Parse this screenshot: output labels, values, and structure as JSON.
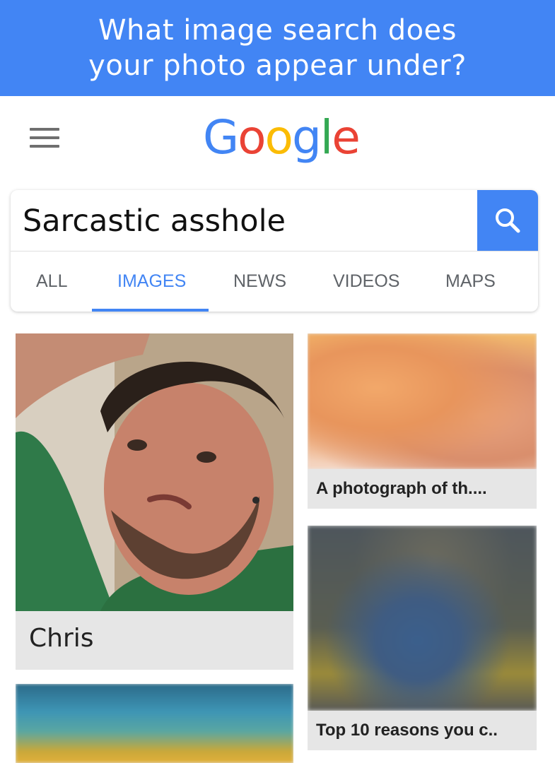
{
  "banner": {
    "line1": "What image search does",
    "line2": "your photo appear under?",
    "background": "#4285f4"
  },
  "header": {
    "menu_icon": "hamburger-menu-icon",
    "logo_letters": [
      "G",
      "o",
      "o",
      "g",
      "l",
      "e"
    ],
    "logo_colors": [
      "#4285f4",
      "#ea4335",
      "#fbbc05",
      "#4285f4",
      "#34a853",
      "#ea4335"
    ]
  },
  "search": {
    "query": "Sarcastic asshole",
    "button_icon": "search-icon",
    "accent": "#4285f4"
  },
  "tabs": [
    {
      "label": "ALL",
      "active": false
    },
    {
      "label": "IMAGES",
      "active": true
    },
    {
      "label": "NEWS",
      "active": false
    },
    {
      "label": "VIDEOS",
      "active": false
    },
    {
      "label": "MAPS",
      "active": false
    }
  ],
  "results": [
    {
      "caption": "Chris"
    },
    {
      "caption": "A photograph of th...."
    },
    {
      "caption": "Top 10 reasons you c.."
    },
    {
      "caption": ""
    }
  ]
}
